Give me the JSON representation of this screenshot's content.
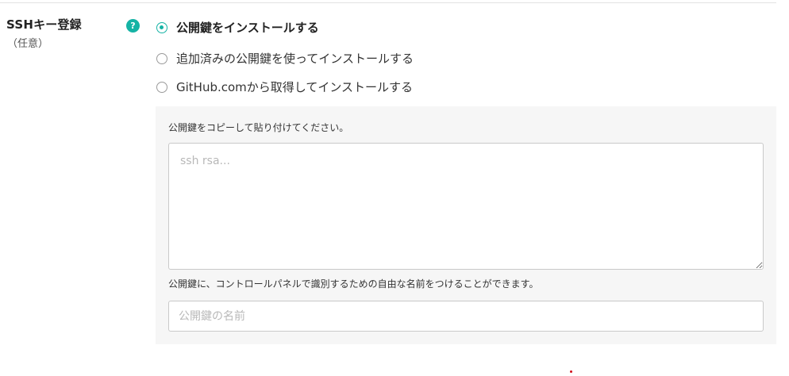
{
  "field": {
    "label": "SSHキー登録",
    "sub_label": "（任意）",
    "help_glyph": "?"
  },
  "accent_color": "#15b3a5",
  "options": [
    {
      "label": "公開鍵をインストールする",
      "selected": true
    },
    {
      "label": "追加済みの公開鍵を使ってインストールする",
      "selected": false
    },
    {
      "label": "GitHub.comから取得してインストールする",
      "selected": false
    }
  ],
  "panel": {
    "instruction": "公開鍵をコピーして貼り付けてください。",
    "key_placeholder": "ssh rsa...",
    "key_value": "",
    "name_description": "公開鍵に、コントロールパネルで識別するための自由な名前をつけることができます。",
    "name_placeholder": "公開鍵の名前",
    "name_value": ""
  }
}
